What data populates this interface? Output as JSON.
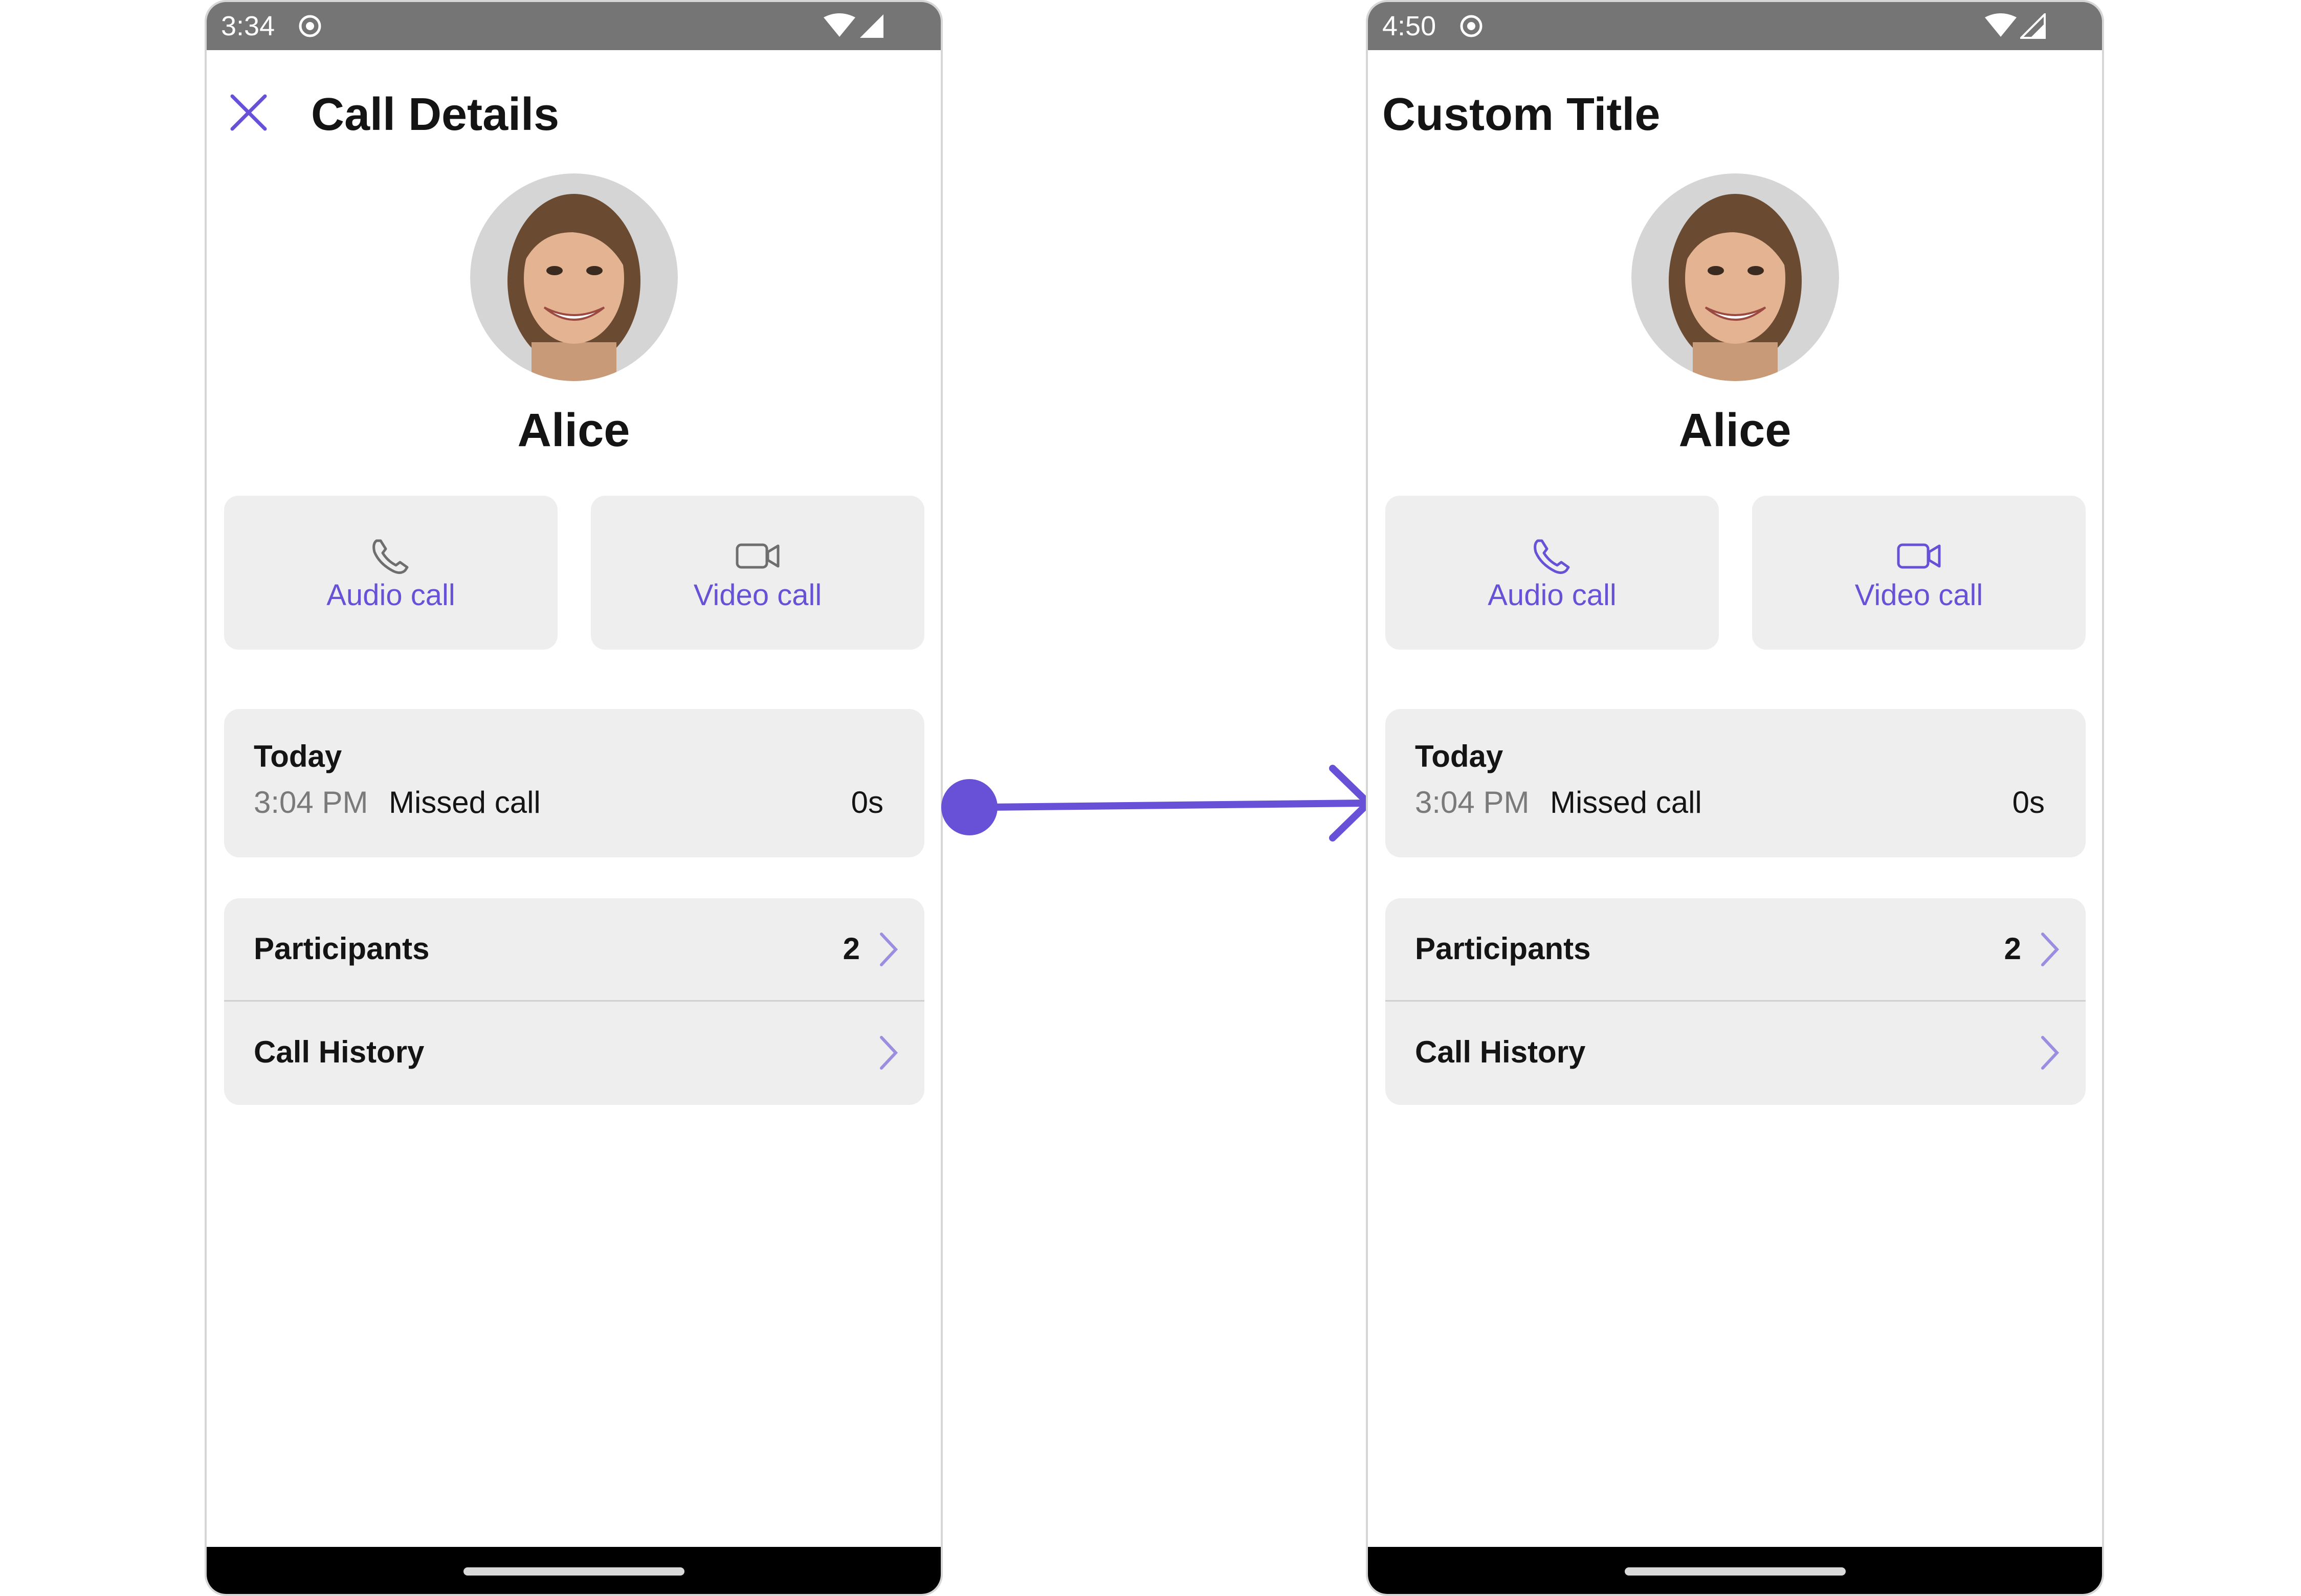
{
  "colors": {
    "accent": "#6851d6",
    "status_bar": "#757575",
    "card_bg": "#eeeeee",
    "nav_bar": "#000000"
  },
  "left_phone": {
    "status": {
      "time": "3:34"
    },
    "header": {
      "title": "Call Details",
      "close_icon": "close-icon"
    },
    "user": {
      "name": "Alice"
    },
    "actions": {
      "audio_label": "Audio call",
      "video_label": "Video call"
    },
    "call": {
      "date": "Today",
      "time": "3:04 PM",
      "status": "Missed call",
      "duration": "0s"
    },
    "options": {
      "participants_label": "Participants",
      "participants_count": "2",
      "history_label": "Call History"
    }
  },
  "right_phone": {
    "status": {
      "time": "4:50"
    },
    "header": {
      "title": "Custom Title"
    },
    "user": {
      "name": "Alice"
    },
    "actions": {
      "audio_label": "Audio call",
      "video_label": "Video call"
    },
    "call": {
      "date": "Today",
      "time": "3:04 PM",
      "status": "Missed call",
      "duration": "0s"
    },
    "options": {
      "participants_label": "Participants",
      "participants_count": "2",
      "history_label": "Call History"
    }
  }
}
